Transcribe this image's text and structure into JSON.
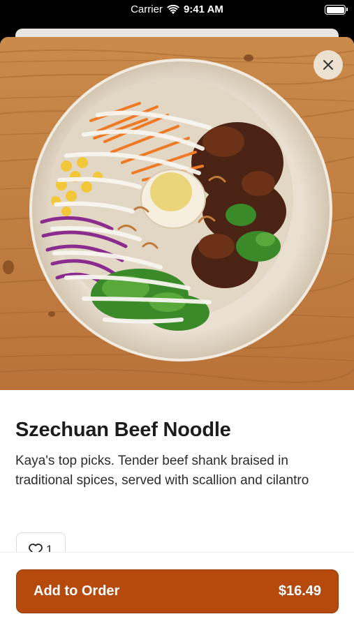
{
  "status_bar": {
    "carrier": "Carrier",
    "time": "9:41 AM",
    "wifi_icon": "wifi-icon",
    "battery_icon": "battery-icon"
  },
  "item": {
    "image_alt": "food-photo",
    "close_icon": "close-icon",
    "title": "Szechuan Beef Noodle",
    "description": "Kaya's top picks. Tender beef shank braised in traditional spices, served with scallion and cilantro",
    "like_icon": "heart-icon",
    "like_count": "1"
  },
  "order": {
    "add_label": "Add to Order",
    "price": "$16.49",
    "button_color": "#b54a0c"
  }
}
